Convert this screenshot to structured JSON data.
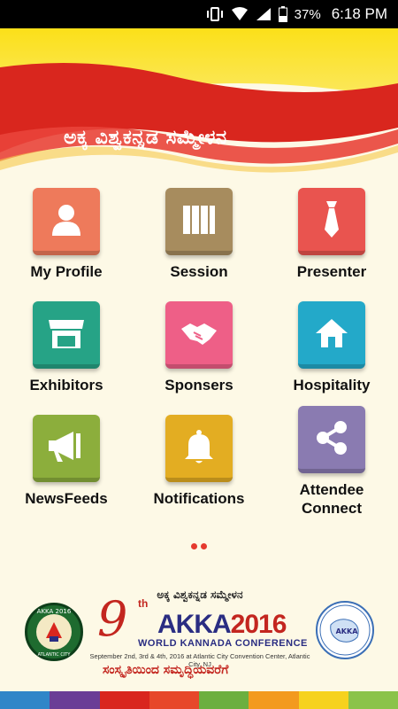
{
  "status_bar": {
    "battery": "37%",
    "time": "6:18 PM"
  },
  "banner": {
    "title": "ಅಕ್ಕ ವಿಶ್ವಕನ್ನಡ ಸಮ್ಮೇಳನ"
  },
  "tiles": [
    {
      "label": "My Profile",
      "icon": "person-icon",
      "color": "#ee7a5b"
    },
    {
      "label": "Session",
      "icon": "columns-icon",
      "color": "#a78c5e"
    },
    {
      "label": "Presenter",
      "icon": "tie-icon",
      "color": "#e9544f"
    },
    {
      "label": "Exhibitors",
      "icon": "storefront-icon",
      "color": "#26a386"
    },
    {
      "label": "Sponsers",
      "icon": "handshake-icon",
      "color": "#ee5f87"
    },
    {
      "label": "Hospitality",
      "icon": "house-icon",
      "color": "#23a9c9"
    },
    {
      "label": "NewsFeeds",
      "icon": "megaphone-icon",
      "color": "#8cae3c"
    },
    {
      "label": "Notifications",
      "icon": "bell-icon",
      "color": "#e3ad22"
    },
    {
      "label": "Attendee\nConnect",
      "label_line1": "Attendee",
      "label_line2": "Connect",
      "icon": "share-icon",
      "color": "#8a7bb1"
    }
  ],
  "pager": {
    "pages": 2,
    "current": 1
  },
  "footer": {
    "top_line": "ಅಕ್ಕ ವಿಶ್ವಕನ್ನಡ ಸಮ್ಮೇಳನ",
    "number": "9",
    "ordinal": "th",
    "akka": "AKKA",
    "year": "2016",
    "conference": "WORLD KANNADA CONFERENCE",
    "address": "September 2nd, 3rd & 4th, 2016 at Atlantic City Convention Center,  Atlantic City, NJ",
    "tagline": "ಸಂಸ್ಕೃತಿಯಿಂದ ಸಮೃದ್ಧಿಯವರೆಗೆ",
    "left_seal_text": "AKKA 2016",
    "left_seal_sub": "ATLANTIC CITY",
    "right_seal_text": "AKKA"
  },
  "colors": {
    "banner_yellow": "#fbe019",
    "banner_red": "#d9261e",
    "strip": [
      "#2f86c8",
      "#6a3d96",
      "#d9261e",
      "#e7472a",
      "#6caf3f",
      "#f39a1e",
      "#f6d21e",
      "#8bc34a"
    ]
  }
}
